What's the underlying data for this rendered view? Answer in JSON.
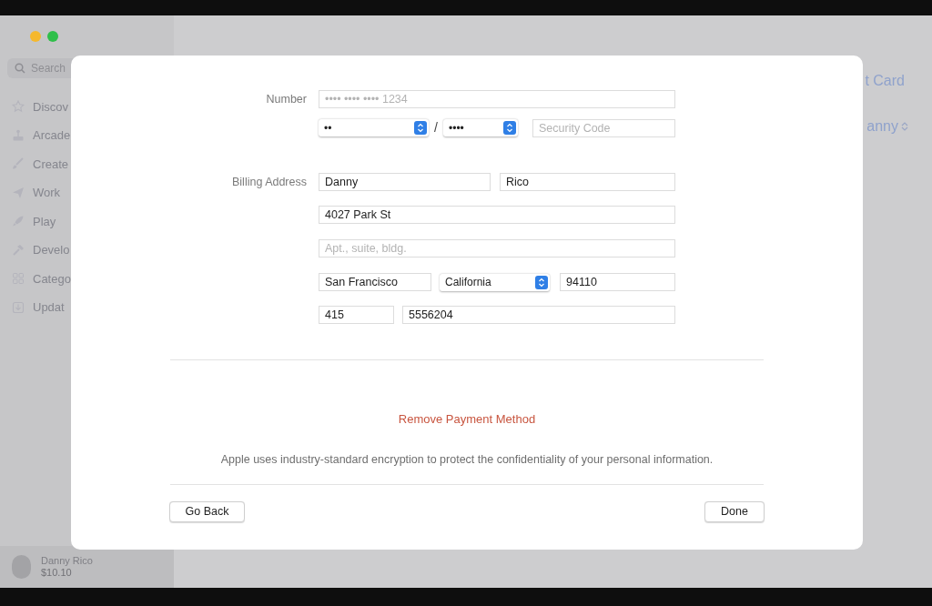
{
  "window": {
    "traffic_lights": [
      {
        "color": "#f5b82e"
      },
      {
        "color": "#2fbf4a"
      }
    ]
  },
  "sidebar": {
    "search": {
      "placeholder": "Search"
    },
    "items": [
      {
        "label": "Discov"
      },
      {
        "label": "Arcade"
      },
      {
        "label": "Create"
      },
      {
        "label": "Work"
      },
      {
        "label": "Play"
      },
      {
        "label": "Develo"
      },
      {
        "label": "Catego"
      },
      {
        "label": "Updat"
      }
    ],
    "account": {
      "name": "Danny Rico",
      "balance": "$10.10"
    }
  },
  "background": {
    "title": "t Card",
    "account_menu": "anny"
  },
  "modal": {
    "rows": [
      {
        "label": "Number",
        "fields": [
          {
            "kind": "text",
            "placeholder": "•••• •••• •••• 1234"
          }
        ]
      },
      {
        "fields": [
          {
            "kind": "select",
            "value": "••"
          },
          {
            "kind": "separator",
            "text": "/"
          },
          {
            "kind": "select",
            "value": "••••"
          },
          {
            "kind": "text",
            "placeholder": "Security Code"
          }
        ]
      },
      {
        "label": "Billing Address",
        "fields": [
          {
            "kind": "text",
            "value": "Danny"
          },
          {
            "kind": "text",
            "value": "Rico"
          }
        ]
      },
      {
        "fields": [
          {
            "kind": "text",
            "value": "4027 Park St"
          }
        ]
      },
      {
        "fields": [
          {
            "kind": "text",
            "placeholder": "Apt., suite, bldg."
          }
        ]
      },
      {
        "fields": [
          {
            "kind": "text",
            "value": "San Francisco"
          },
          {
            "kind": "select",
            "value": "California"
          },
          {
            "kind": "text",
            "value": "94110"
          }
        ]
      },
      {
        "fields": [
          {
            "kind": "text",
            "value": "415"
          },
          {
            "kind": "text",
            "value": "5556204"
          }
        ]
      }
    ],
    "remove_link": "Remove Payment Method",
    "notice": "Apple uses industry-standard encryption to protect the confidentiality of your personal information.",
    "buttons": [
      {
        "label": "Go Back"
      },
      {
        "label": "Done"
      }
    ]
  }
}
